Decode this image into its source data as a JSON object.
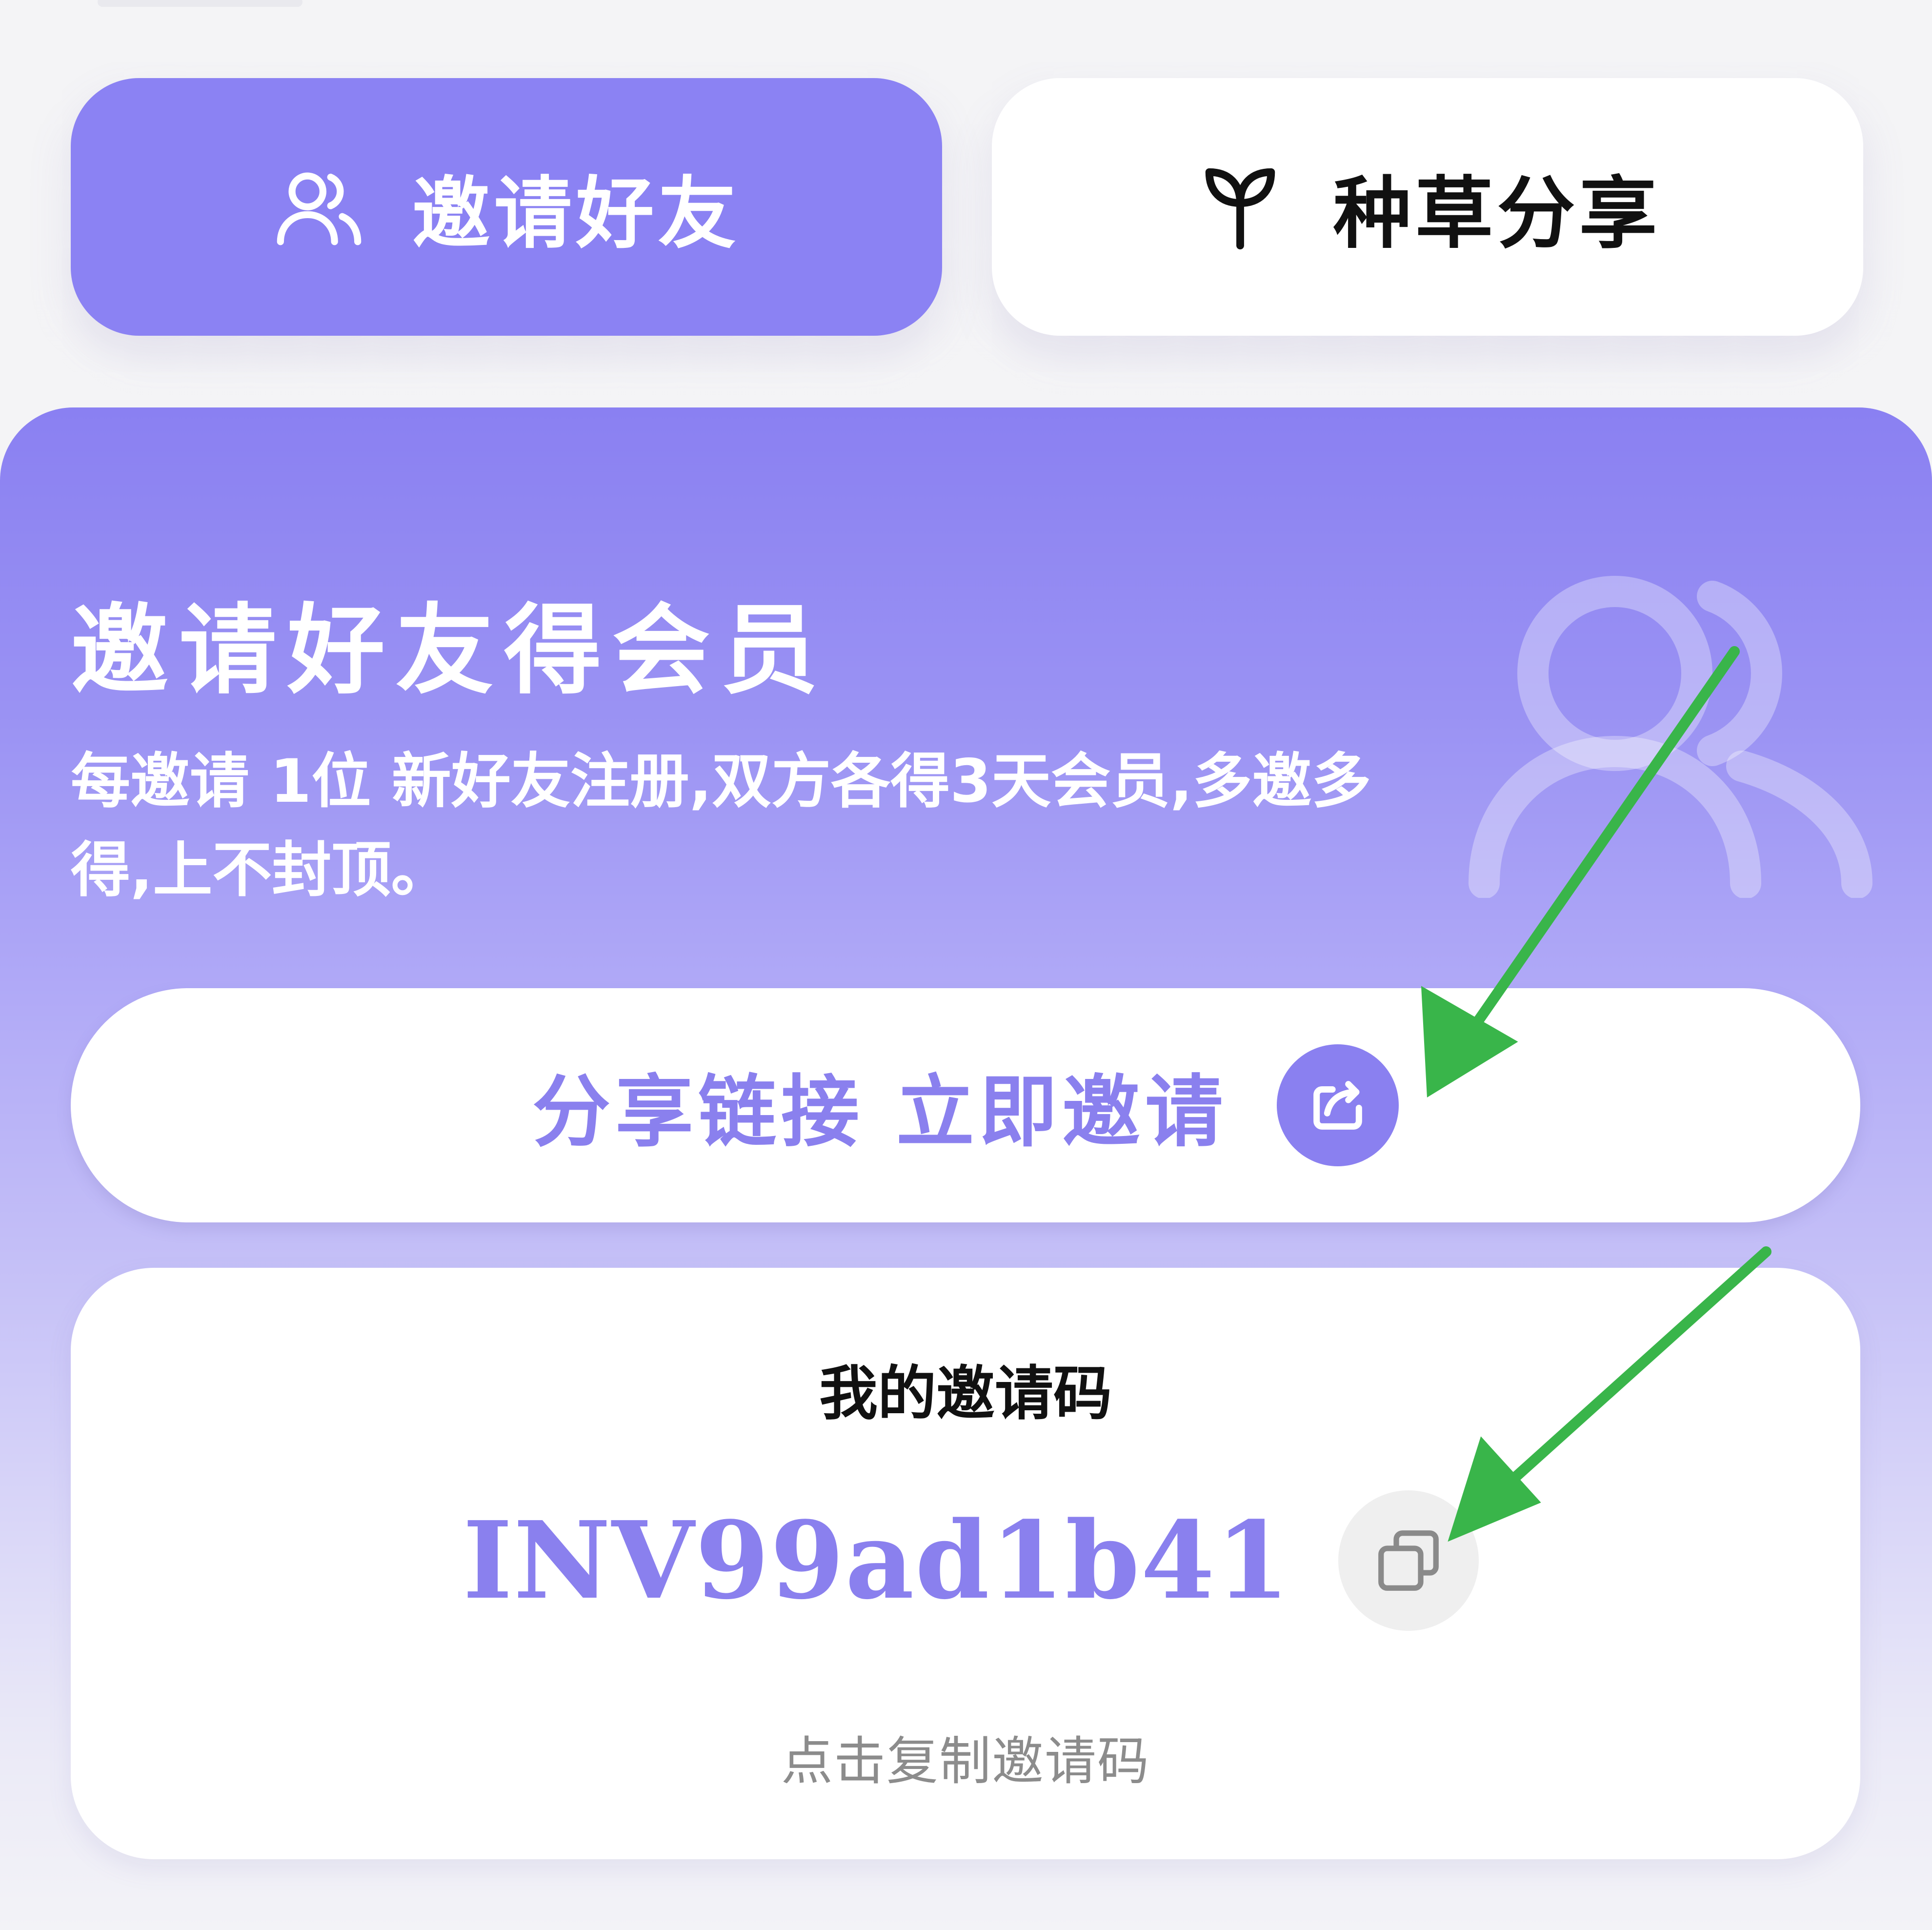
{
  "tabs": {
    "invite_label": "邀请好友",
    "share_label": "种草分享",
    "active": "invite"
  },
  "hero": {
    "title": "邀请好友得会员",
    "description": "每邀请 1位 新好友注册,双方各得3天会员,多邀多得,上不封顶。"
  },
  "share_button": {
    "label": "分享链接 立即邀请"
  },
  "invite_code": {
    "title": "我的邀请码",
    "code": "INV99ad1b41",
    "hint": "点击复制邀请码"
  },
  "colors": {
    "accent": "#8b82f3",
    "accent_text": "#8a80ee",
    "annotation_arrow": "#39b54a",
    "hint_text": "#8c8c8c"
  },
  "icons": {
    "invite_tab": "users-icon",
    "share_tab": "sprout-icon",
    "hero": "users-icon",
    "share_button": "share-icon",
    "copy": "copy-icon"
  }
}
